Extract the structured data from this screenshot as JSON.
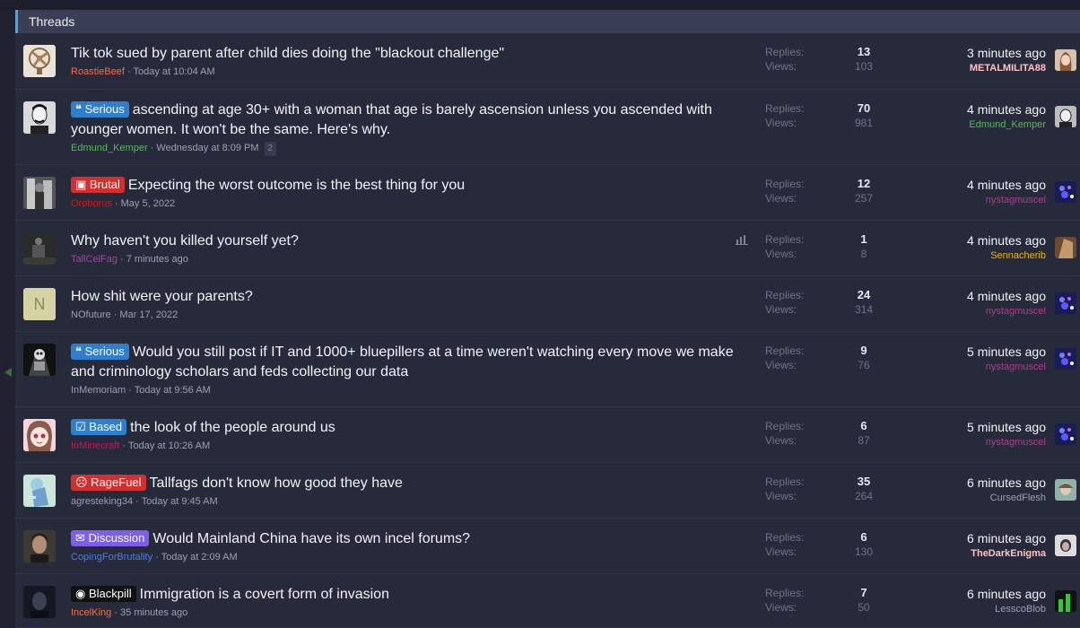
{
  "block": {
    "title": "Threads"
  },
  "labels": {
    "replies": "Replies:",
    "views": "Views:"
  },
  "threads": [
    {
      "prefix": "",
      "prefix_type": "",
      "title": "Tik tok sued by parent after child dies doing the \"blackout challenge\"",
      "author": "RoastieBeef",
      "author_color": "#ff6b3d",
      "date": "Today at 10:04 AM",
      "pages": "",
      "replies": "13",
      "views": "103",
      "latest_time": "3 minutes ago",
      "latest_user": "METALMILITA88",
      "latest_user_color": "#ffc2c2",
      "latest_bold": true,
      "avatar_icon": "fan-avatar-icon"
    },
    {
      "prefix": "Serious",
      "prefix_type": "serious",
      "title": "ascending at age 30+ with a woman that age is barely ascension unless you ascended with younger women. It won't be the same. Here's why.",
      "author": "Edmund_Kemper",
      "author_color": "#58b85c",
      "date": "Wednesday at 8:09 PM",
      "pages": "2",
      "replies": "70",
      "views": "981",
      "latest_time": "4 minutes ago",
      "latest_user": "Edmund_Kemper",
      "latest_user_color": "#58b85c",
      "latest_bold": false,
      "avatar_icon": "man-portrait-avatar-icon"
    },
    {
      "prefix": "Brutal",
      "prefix_type": "brutal",
      "title": "Expecting the worst outcome is the best thing for you",
      "author": "Oroborus",
      "author_color": "#c42020",
      "date": "May 5, 2022",
      "pages": "",
      "replies": "12",
      "views": "257",
      "latest_time": "4 minutes ago",
      "latest_user": "nystagmuscel",
      "latest_user_color": "#b23a92",
      "latest_bold": false,
      "avatar_icon": "gray-figure-avatar-icon"
    },
    {
      "prefix": "",
      "prefix_type": "",
      "title": "Why haven't you killed yourself yet?",
      "author": "TallCelFag",
      "author_color": "#a0479a",
      "date": "7 minutes ago",
      "pages": "",
      "poll": true,
      "replies": "1",
      "views": "8",
      "latest_time": "4 minutes ago",
      "latest_user": "Sennacherib",
      "latest_user_color": "#e7b51f",
      "latest_bold": false,
      "avatar_icon": "dark-scene-avatar-icon"
    },
    {
      "prefix": "",
      "prefix_type": "",
      "title": "How shit were your parents?",
      "author": "NOfuture",
      "author_color": "#9aa0b5",
      "date": "Mar 17, 2022",
      "pages": "",
      "replies": "24",
      "views": "314",
      "latest_time": "4 minutes ago",
      "latest_user": "nystagmuscel",
      "latest_user_color": "#b23a92",
      "latest_bold": false,
      "avatar_letter": "N"
    },
    {
      "prefix": "Serious",
      "prefix_type": "serious",
      "title": "Would you still post if IT and 1000+ bluepillers at a time weren't watching every move we make and criminology scholars and feds collecting our data",
      "author": "InMemoriam",
      "author_color": "#9aa0b5",
      "date": "Today at 9:56 AM",
      "pages": "",
      "replies": "9",
      "views": "76",
      "latest_time": "5 minutes ago",
      "latest_user": "nystagmuscel",
      "latest_user_color": "#b23a92",
      "latest_bold": false,
      "avatar_icon": "dark-skull-avatar-icon"
    },
    {
      "prefix": "Based",
      "prefix_type": "based",
      "title": "the look of the people around us",
      "author": "InMinecraft",
      "author_color": "#c2185b",
      "date": "Today at 10:26 AM",
      "pages": "",
      "replies": "6",
      "views": "87",
      "latest_time": "5 minutes ago",
      "latest_user": "nystagmuscel",
      "latest_user_color": "#b23a92",
      "latest_bold": false,
      "avatar_icon": "anime-girl-avatar-icon"
    },
    {
      "prefix": "RageFuel",
      "prefix_type": "ragefuel",
      "title": "Tallfags don't know how good they have",
      "author": "agresteking34",
      "author_color": "#9aa0b5",
      "date": "Today at 9:45 AM",
      "pages": "",
      "replies": "35",
      "views": "264",
      "latest_time": "6 minutes ago",
      "latest_user": "CursedFlesh",
      "latest_user_color": "#9aa0b5",
      "latest_bold": false,
      "avatar_icon": "anime-figure-avatar-icon"
    },
    {
      "prefix": "Discussion",
      "prefix_type": "discussion",
      "title": "Would Mainland China have its own incel forums?",
      "author": "CopingForBrutality",
      "author_color": "#4f7fd8",
      "date": "Today at 2:09 AM",
      "pages": "",
      "replies": "6",
      "views": "130",
      "latest_time": "6 minutes ago",
      "latest_user": "TheDarkEnigma",
      "latest_user_color": "#ffc2c2",
      "latest_bold": true,
      "avatar_icon": "man-dark-avatar-icon"
    },
    {
      "prefix": "Blackpill",
      "prefix_type": "blackpill",
      "title": "Immigration is a covert form of invasion",
      "author": "IncelKing",
      "author_color": "#ff6b3d",
      "date": "35 minutes ago",
      "pages": "",
      "replies": "7",
      "views": "50",
      "latest_time": "6 minutes ago",
      "latest_user": "LesscoBlob",
      "latest_user_color": "#9aa0b5",
      "latest_bold": false,
      "avatar_icon": "dark-man-avatar-icon"
    }
  ]
}
